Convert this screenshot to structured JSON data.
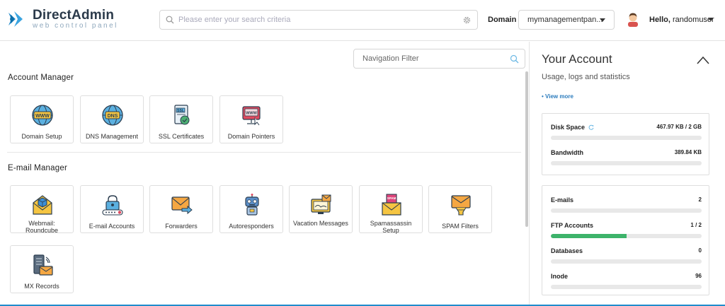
{
  "header": {
    "logo_title": "DirectAdmin",
    "logo_subtitle": "web control panel",
    "search_placeholder": "Please enter your search criteria",
    "domain_label": "Domain",
    "domain_value": "mymanagementpan...",
    "hello_prefix": "Hello,",
    "username": "randomuser"
  },
  "nav_filter": {
    "placeholder": "Navigation Filter"
  },
  "account_manager": {
    "title": "Account Manager",
    "tiles": [
      {
        "label": "Domain Setup",
        "icon": "www-globe-icon"
      },
      {
        "label": "DNS Management",
        "icon": "dns-globe-icon"
      },
      {
        "label": "SSL Certificates",
        "icon": "ssl-certificate-icon"
      },
      {
        "label": "Domain Pointers",
        "icon": "domain-pointer-icon"
      }
    ]
  },
  "email_manager": {
    "title": "E-mail Manager",
    "tiles": [
      {
        "label": "Webmail: Roundcube",
        "icon": "webmail-envelope-icon"
      },
      {
        "label": "E-mail Accounts",
        "icon": "email-account-lock-icon"
      },
      {
        "label": "Forwarders",
        "icon": "forward-envelope-icon"
      },
      {
        "label": "Autoresponders",
        "icon": "robot-icon"
      },
      {
        "label": "Vacation Messages",
        "icon": "vacation-monitor-icon"
      },
      {
        "label": "Spamassassin Setup",
        "icon": "spam-envelope-icon"
      },
      {
        "label": "SPAM Filters",
        "icon": "spam-filter-icon"
      },
      {
        "label": "MX Records",
        "icon": "mx-server-icon"
      }
    ]
  },
  "sidebar": {
    "title": "Your Account",
    "subtitle": "Usage, logs and statistics",
    "view_more": "• View more",
    "stats_top": [
      {
        "name": "Disk Space",
        "value": "467.97 KB / 2 GB",
        "fill": 0
      },
      {
        "name": "Bandwidth",
        "value": "389.84 KB",
        "fill": 0
      }
    ],
    "stats_bottom": [
      {
        "name": "E-mails",
        "value": "2",
        "fill": 0
      },
      {
        "name": "FTP Accounts",
        "value": "1 / 2",
        "fill": 0.5
      },
      {
        "name": "Databases",
        "value": "0",
        "fill": 0
      },
      {
        "name": "Inode",
        "value": "96",
        "fill": 0
      }
    ]
  },
  "colors": {
    "accent": "#1f8ccc",
    "progress": "#3db36a",
    "brand": "#2b3a4a"
  }
}
